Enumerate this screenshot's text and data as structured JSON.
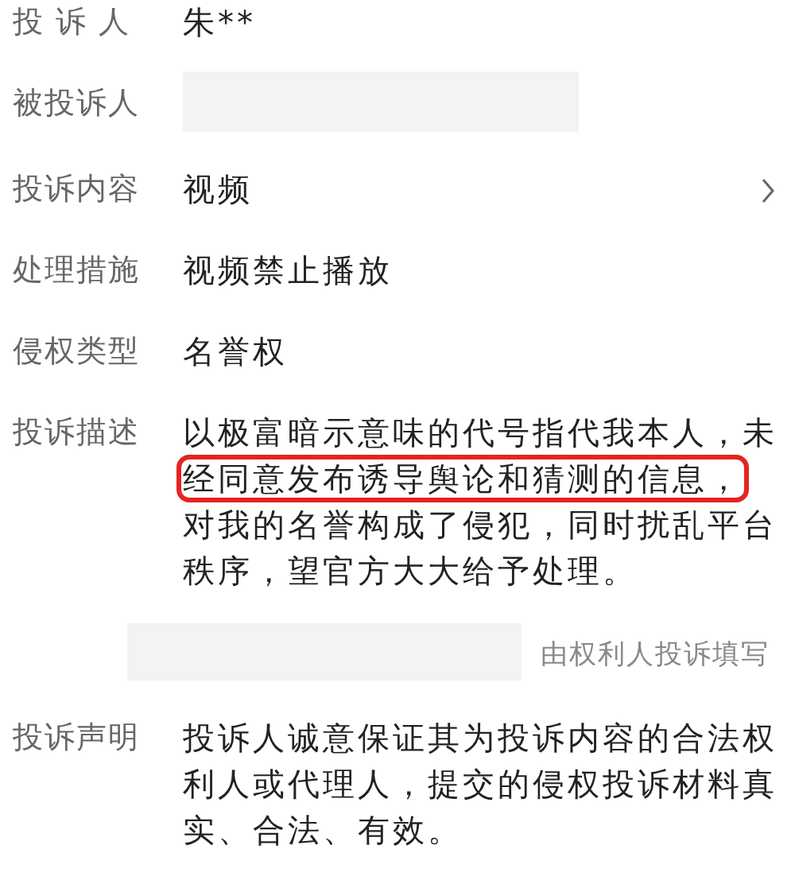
{
  "rows": [
    {
      "kind": "text",
      "label": "投 诉 人",
      "value": "朱**"
    },
    {
      "kind": "redacted",
      "label": "被投诉人"
    },
    {
      "kind": "link",
      "label": "投诉内容",
      "value": "视频"
    },
    {
      "kind": "text",
      "label": "处理措施",
      "value": "视频禁止播放"
    },
    {
      "kind": "text",
      "label": "侵权类型",
      "value": "名誉权"
    },
    {
      "kind": "highlighted",
      "label": "投诉描述",
      "before": "以极富暗示意味的代号指代我本人，未",
      "highlight": "经同意发布诱导舆论和猜测的信息，",
      "after": "对我的名誉构成了侵犯，同时扰乱平台秩序，望官方大大给予处理。"
    },
    {
      "kind": "note",
      "note": "由权利人投诉填写"
    },
    {
      "kind": "text",
      "label": "投诉声明",
      "value": "投诉人诚意保证其为投诉内容的合法权利人或代理人，提交的侵权投诉材料真实、合法、有效。"
    }
  ]
}
